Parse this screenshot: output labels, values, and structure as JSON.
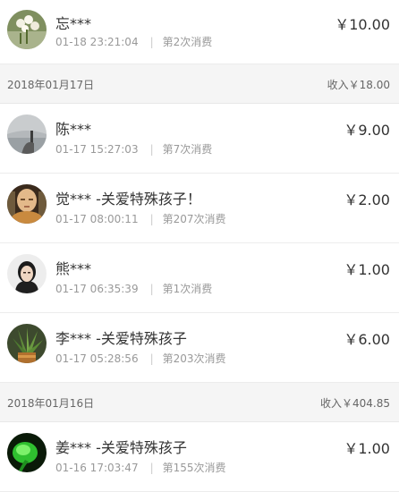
{
  "days": [
    {
      "header": null,
      "items": [
        {
          "name": "忘***",
          "time": "01-18 23:21:04",
          "count": "第2次消费",
          "amount": "￥10.00",
          "avatar": "flowers-avatar"
        }
      ]
    },
    {
      "header": {
        "date": "2018年01月17日",
        "income": "收入￥18.00"
      },
      "items": [
        {
          "name": "陈***",
          "time": "01-17 15:27:03",
          "count": "第7次消费",
          "amount": "￥9.00",
          "avatar": "lake-avatar"
        },
        {
          "name": "觉*** -关爱特殊孩子！",
          "time": "01-17 08:00:11",
          "count": "第207次消费",
          "amount": "￥2.00",
          "avatar": "buddha-avatar"
        },
        {
          "name": "熊***",
          "time": "01-17 06:35:39",
          "count": "第1次消费",
          "amount": "￥1.00",
          "avatar": "portrait-avatar"
        },
        {
          "name": "李*** -关爱特殊孩子",
          "time": "01-17 05:28:56",
          "count": "第203次消费",
          "amount": "￥6.00",
          "avatar": "plant-avatar"
        }
      ]
    },
    {
      "header": {
        "date": "2018年01月16日",
        "income": "收入￥404.85"
      },
      "items": [
        {
          "name": "姜*** -关爱特殊孩子",
          "time": "01-16 17:03:47",
          "count": "第155次消费",
          "amount": "￥1.00",
          "avatar": "green-leaf-avatar"
        }
      ]
    }
  ],
  "colors": {
    "background": "#ffffff",
    "header_background": "#f5f5f5",
    "primary_text": "#333333",
    "secondary_text": "#999999"
  }
}
